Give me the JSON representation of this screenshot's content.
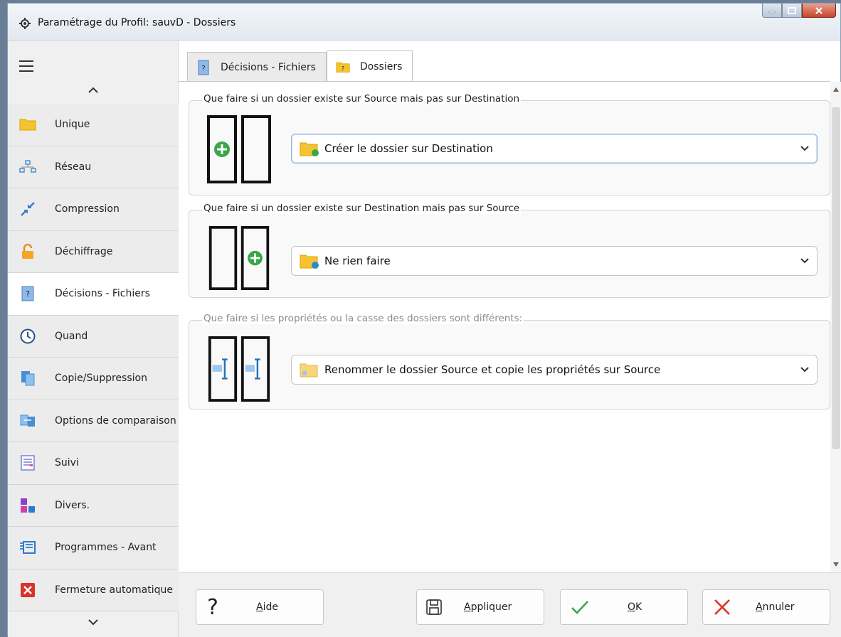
{
  "window": {
    "title": "Paramétrage du Profil: sauvD - Dossiers"
  },
  "sidebar": {
    "items": [
      {
        "label": "Unique",
        "icon": "folder-icon"
      },
      {
        "label": "Réseau",
        "icon": "network-icon"
      },
      {
        "label": "Compression",
        "icon": "compress-icon"
      },
      {
        "label": "Déchiffrage",
        "icon": "unlock-icon"
      },
      {
        "label": "Décisions - Fichiers",
        "icon": "question-doc-icon",
        "active": true
      },
      {
        "label": "Quand",
        "icon": "clock-icon"
      },
      {
        "label": "Copie/Suppression",
        "icon": "copy-icon"
      },
      {
        "label": "Options de comparaison",
        "icon": "compare-icon"
      },
      {
        "label": "Suivi",
        "icon": "log-icon"
      },
      {
        "label": "Divers.",
        "icon": "blocks-icon"
      },
      {
        "label": "Programmes - Avant",
        "icon": "program-icon"
      },
      {
        "label": "Fermeture automatique",
        "icon": "close-red-icon"
      }
    ]
  },
  "tabs": [
    {
      "label": "Décisions - Fichiers",
      "active": false
    },
    {
      "label": "Dossiers",
      "active": true
    }
  ],
  "groups": [
    {
      "title": "Que faire si un dossier existe sur Source mais pas sur Destination",
      "value": "Créer le dossier sur Destination"
    },
    {
      "title": "Que faire si un dossier existe sur Destination mais pas sur Source",
      "value": "Ne rien faire"
    },
    {
      "title": "Que faire si les propriétés ou la casse des dossiers sont différents:",
      "value": "Renommer le dossier Source et copie les propriétés sur Source"
    }
  ],
  "footer": {
    "help": {
      "pre": "",
      "accel": "A",
      "post": "ide"
    },
    "apply": {
      "pre": "",
      "accel": "A",
      "post": "ppliquer"
    },
    "ok": {
      "pre": "",
      "accel": "O",
      "post": "K"
    },
    "cancel": {
      "pre": "",
      "accel": "A",
      "post": "nnuler"
    }
  },
  "colors": {
    "accent_green": "#3aa64a",
    "close_red": "#d9342b",
    "folder_yellow": "#f4c430"
  }
}
